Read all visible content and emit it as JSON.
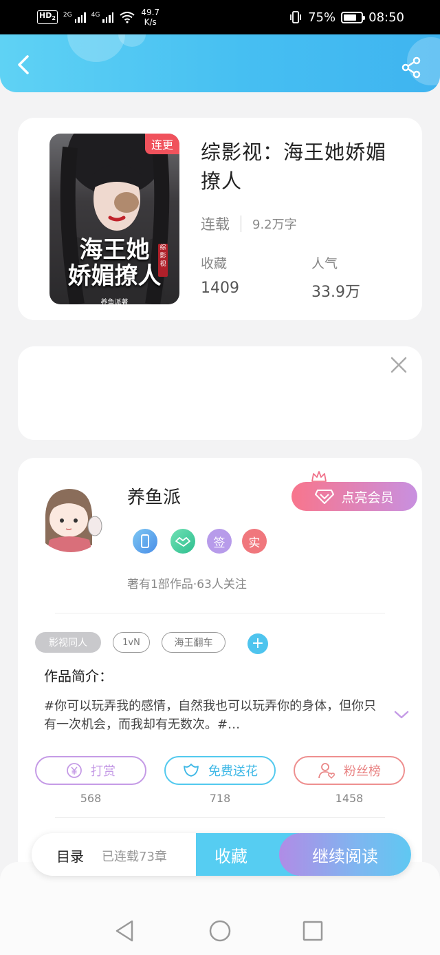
{
  "status_bar": {
    "hd_label": "HD",
    "hd_sub": "2",
    "signal1_label": "2G",
    "signal2_label": "4G",
    "net_speed_value": "49.7",
    "net_speed_unit": "K/s",
    "battery_percent": "75%",
    "battery_level": 0.75,
    "time": "08:50"
  },
  "header": {
    "colors": {
      "start": "#5fd2f4",
      "end": "#3fb4f0"
    }
  },
  "book": {
    "cover_tag": "连更",
    "cover_title_line1": "海王她",
    "cover_title_line2": "娇媚撩人",
    "cover_red_tag": "综影视",
    "cover_author": "养鱼派著",
    "title": "综影视：海王她娇媚撩人",
    "status": "连载",
    "word_count": "9.2万字",
    "collect_label": "收藏",
    "collect_value": "1409",
    "popularity_label": "人气",
    "popularity_value": "33.9万"
  },
  "author": {
    "name": "养鱼派",
    "vip_button": "点亮会员",
    "badge_sign": "签",
    "badge_real": "实",
    "works_info": "著有1部作品·63人关注"
  },
  "tags": [
    "影视同人",
    "1vN",
    "海王翻车"
  ],
  "intro": {
    "title": "作品简介：",
    "text": "#你可以玩弄我的感情，自然我也可以玩弄你的身体，但你只有一次机会，而我却有无数次。#…"
  },
  "actions": [
    {
      "label": "打赏",
      "count": "568",
      "color": "#c59be6"
    },
    {
      "label": "免费送花",
      "count": "718",
      "color": "#52c9ee"
    },
    {
      "label": "粉丝榜",
      "count": "1458",
      "color": "#ee8f8f"
    }
  ],
  "bottom_bar": {
    "toc_label": "目录",
    "chapter_count": "已连载73章",
    "collect_button": "收藏",
    "continue_button": "继续阅读"
  }
}
